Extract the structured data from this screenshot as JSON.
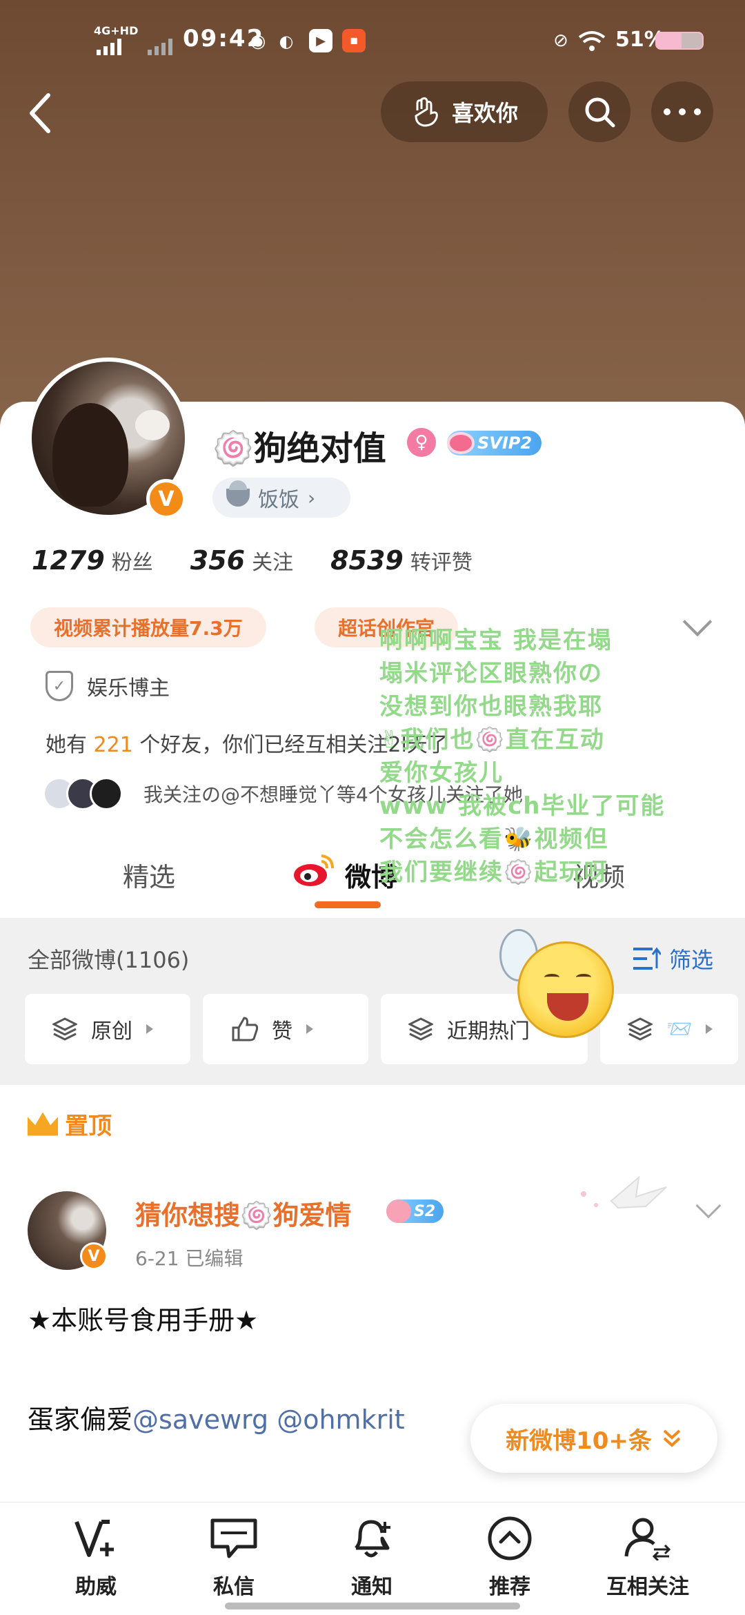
{
  "status_bar": {
    "network": "4G+HD",
    "time": "09:42",
    "battery_pct": "51%"
  },
  "header": {
    "like_label": "喜欢你"
  },
  "profile": {
    "username": "🍥狗绝对值",
    "svip_label": "SVIP2",
    "group_label": "饭饭",
    "stats": [
      {
        "value": "1279",
        "label": "粉丝"
      },
      {
        "value": "356",
        "label": "关注"
      },
      {
        "value": "8539",
        "label": "转评赞"
      }
    ],
    "tags": [
      "视频累计播放量7.3万",
      "超话创作官"
    ],
    "verification": "娱乐博主",
    "friends_prefix": "她有",
    "friends_count": "221",
    "friends_suffix": "个好友，你们已经互相关注2l天了",
    "mutual_text": "我关注の@不想睡觉丫等4个女孩儿关注了她"
  },
  "tabs": {
    "featured": "精选",
    "weibo": "微博",
    "video": "视频"
  },
  "feed_header": {
    "all_weibo": "全部微博(1106)",
    "filter": "筛选",
    "chips": [
      "原创",
      "赞",
      "近期热门",
      "📨"
    ]
  },
  "pinned_label": "置顶",
  "post": {
    "author": "猜你想搜🍥狗爱情",
    "level": "S2",
    "meta": "6-21  已编辑",
    "line1": "★本账号食用手册★",
    "line2_prefix": "蛋家偏爱",
    "mention1": "@savewrg",
    "mention2": "@ohmkrit"
  },
  "new_weibo_label": "新微博10+条",
  "overlay_comment": [
    "啊啊啊宝宝 我是在塌",
    "塌米评论区眼熟你の",
    "没想到你也眼熟我耶",
    "✌我们也🍥直在互动",
    "爱你女孩儿",
    "www 我被ch毕业了可能",
    "不会怎么看🐝视频但",
    "我们要继续🍥起玩呀"
  ],
  "bottom_nav": [
    {
      "label": "助威",
      "icon": "cheer-icon"
    },
    {
      "label": "私信",
      "icon": "message-icon"
    },
    {
      "label": "通知",
      "icon": "bell-icon"
    },
    {
      "label": "推荐",
      "icon": "recommend-icon"
    },
    {
      "label": "互相关注",
      "icon": "mutual-follow-icon"
    }
  ],
  "colors": {
    "banner": "#7d5a41",
    "accent_orange": "#f08a1c",
    "tab_underline": "#f36b22",
    "overlay_green": "#93d98a",
    "link_blue": "#2a6fc9"
  }
}
